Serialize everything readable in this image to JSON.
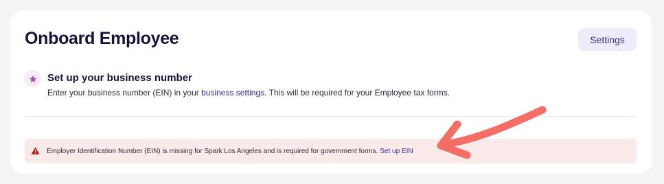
{
  "header": {
    "title": "Onboard Employee",
    "settings_label": "Settings"
  },
  "step": {
    "icon": "star-icon",
    "title": "Set up your business number",
    "desc_before": "Enter your business number (EIN) in your ",
    "desc_link": "business settings",
    "desc_after": ". This will be required for your Employee tax forms."
  },
  "alert": {
    "icon": "warning-icon",
    "message": "Employer Identification Number (EIN) is missing for Spark Los Angeles and is required for government forms.",
    "link": "Set up EIN"
  },
  "colors": {
    "title": "#14133b",
    "link": "#2e2a9e",
    "alert_bg": "#fbeaea",
    "warning_icon": "#b42318",
    "annotation_arrow": "#f56e66",
    "star": "#a0509f"
  }
}
